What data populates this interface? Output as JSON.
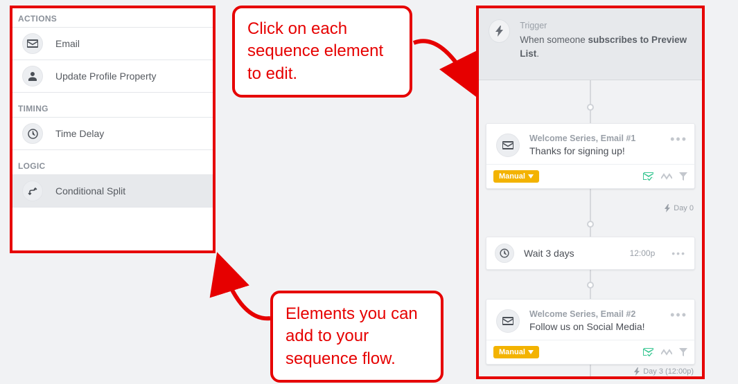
{
  "sidebar": {
    "sections": {
      "actions": {
        "header": "ACTIONS",
        "items": [
          {
            "label": "Email",
            "icon": "envelope"
          },
          {
            "label": "Update Profile Property",
            "icon": "user"
          }
        ]
      },
      "timing": {
        "header": "TIMING",
        "items": [
          {
            "label": "Time Delay",
            "icon": "clock"
          }
        ]
      },
      "logic": {
        "header": "LOGIC",
        "items": [
          {
            "label": "Conditional Split",
            "icon": "branch"
          }
        ]
      }
    }
  },
  "flow": {
    "trigger": {
      "label": "Trigger",
      "text_prefix": "When someone ",
      "text_bold": "subscribes to Preview List",
      "text_suffix": "."
    },
    "steps": [
      {
        "type": "email",
        "title": "Welcome Series, Email #1",
        "subject": "Thanks for signing up!",
        "badge": "Manual",
        "day_label": "Day 0"
      },
      {
        "type": "wait",
        "text": "Wait 3 days",
        "time": "12:00p"
      },
      {
        "type": "email",
        "title": "Welcome Series, Email #2",
        "subject": "Follow us on Social Media!",
        "badge": "Manual",
        "day_label": "Day 3 (12:00p)"
      }
    ]
  },
  "callouts": {
    "top": "Click on each sequence element to edit.",
    "bottom": "Elements you can add to your sequence flow."
  },
  "colors": {
    "annotation": "#e60000",
    "badge": "#f3b301",
    "ok": "#2cc38b"
  }
}
